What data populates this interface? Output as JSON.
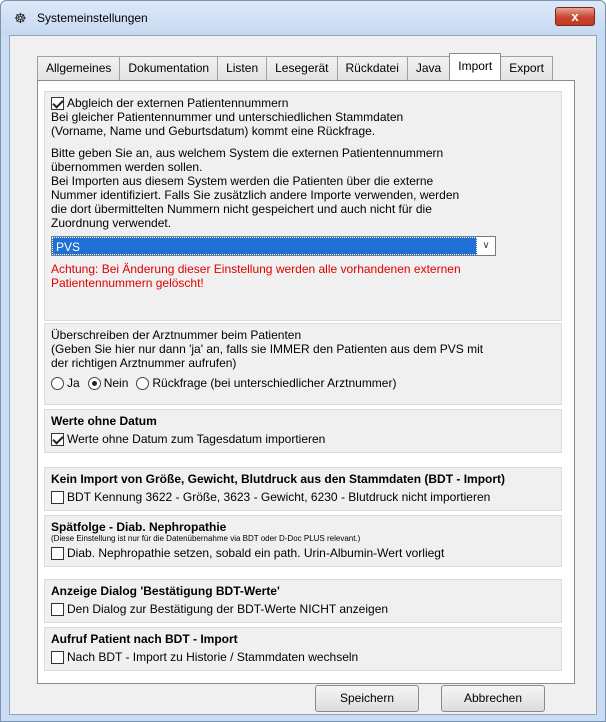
{
  "window": {
    "title": "Systemeinstellungen",
    "close_label": "x"
  },
  "tabs": [
    "Allgemeines",
    "Dokumentation",
    "Listen",
    "Lesegerät",
    "Rückdatei",
    "Java",
    "Import",
    "Export"
  ],
  "active_tab": "Import",
  "section1": {
    "checkbox_label": "Abgleich der externen Patientennummern",
    "text1": "Bei gleicher Patientennummer und unterschiedlichen Stammdaten",
    "text2": "(Vorname, Name und Geburtsdatum) kommt eine Rückfrage.",
    "text3": "Bitte geben Sie an, aus welchem System die externen Patientennummern",
    "text4": "übernommen werden sollen.",
    "text5": "Bei Importen aus diesem System werden die Patienten über die externe",
    "text6": "Nummer identifiziert. Falls Sie zusätzlich andere Importe verwenden, werden",
    "text7": "die dort übermittelten Nummern nicht gespeichert und auch nicht für die",
    "text8": "Zuordnung verwendet.",
    "select_value": "PVS",
    "warning1": "Achtung: Bei Änderung dieser Einstellung werden alle vorhandenen externen",
    "warning2": "Patientennummern gelöscht!"
  },
  "section2": {
    "text1": "Überschreiben der Arztnummer beim Patienten",
    "text2": "(Geben Sie hier nur dann 'ja' an, falls sie IMMER den Patienten aus dem PVS mit",
    "text3": "der richtigen Arztnummer aufrufen)",
    "radio_ja": "Ja",
    "radio_nein": "Nein",
    "radio_rueckfrage": "Rückfrage (bei unterschiedlicher Arztnummer)"
  },
  "section3": {
    "title": "Werte ohne Datum",
    "checkbox_label": "Werte ohne Datum zum Tagesdatum importieren"
  },
  "section4": {
    "title": "Kein Import von Größe, Gewicht, Blutdruck aus den Stammdaten (BDT - Import)",
    "checkbox_label": "BDT Kennung 3622 - Größe, 3623 - Gewicht, 6230 - Blutdruck nicht importieren"
  },
  "section5": {
    "title": "Spätfolge - Diab. Nephropathie",
    "note": "(Diese Einstellung ist nur für die Datenübernahme via BDT oder D-Doc PLUS relevant.)",
    "checkbox_label": "Diab. Nephropathie setzen, sobald ein path. Urin-Albumin-Wert vorliegt"
  },
  "section6": {
    "title": "Anzeige Dialog 'Bestätigung BDT-Werte'",
    "checkbox_label": "Den Dialog zur Bestätigung der BDT-Werte NICHT anzeigen"
  },
  "section7": {
    "title": "Aufruf Patient nach BDT - Import",
    "checkbox_label": "Nach BDT - Import zu Historie / Stammdaten wechseln"
  },
  "buttons": {
    "save": "Speichern",
    "cancel": "Abbrechen"
  }
}
